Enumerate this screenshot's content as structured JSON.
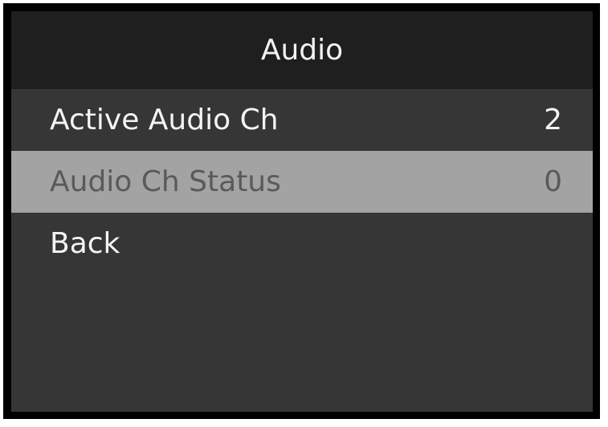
{
  "menu": {
    "title": "Audio",
    "items": [
      {
        "label": "Active Audio Ch",
        "value": "2"
      },
      {
        "label": "Audio Ch Status",
        "value": "0"
      },
      {
        "label": "Back",
        "value": ""
      }
    ],
    "selected_index": 1
  },
  "colors": {
    "frame": "#000000",
    "title_bg": "#1f1f1f",
    "menu_bg": "#363636",
    "selected_bg": "#a3a3a3",
    "text": "#f4f4f4",
    "selected_text": "#5a5a5a"
  }
}
